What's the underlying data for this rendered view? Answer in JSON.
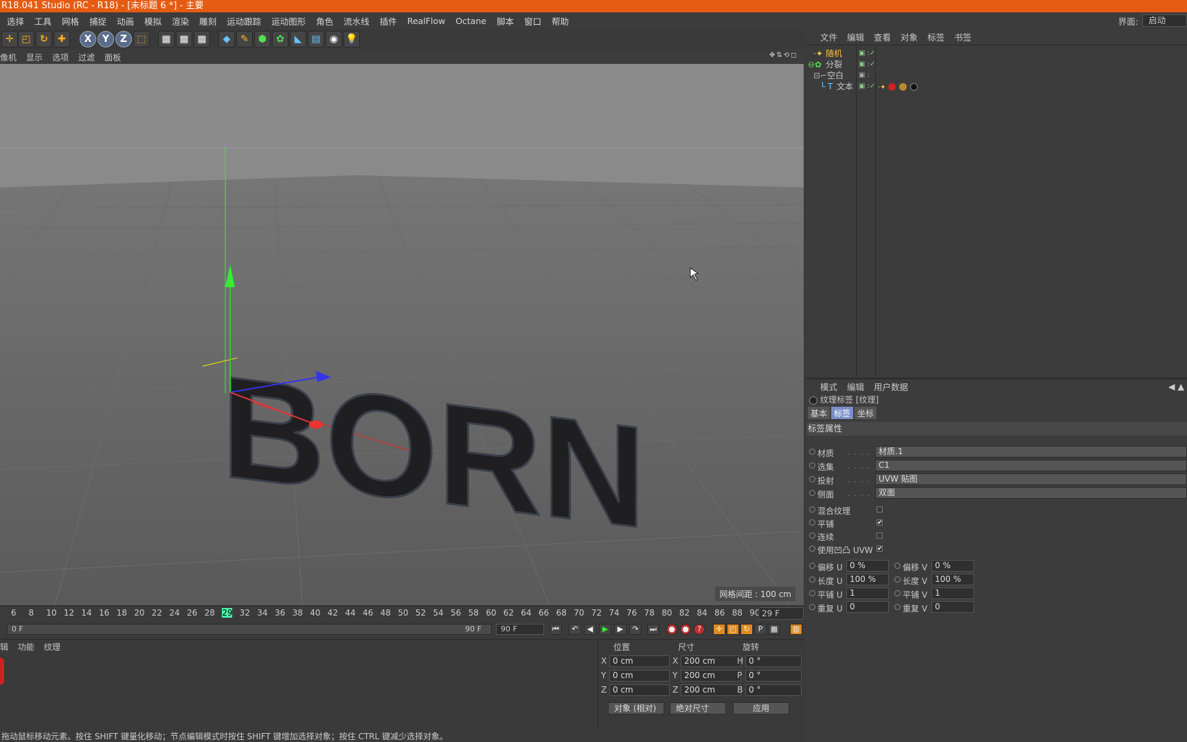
{
  "window": {
    "title": "R18.041 Studio (RC - R18) - [未标题 6 *] - 主要"
  },
  "menu": {
    "items": [
      "选择",
      "工具",
      "网格",
      "捕捉",
      "动画",
      "模拟",
      "渲染",
      "雕刻",
      "运动跟踪",
      "运动图形",
      "角色",
      "流水线",
      "插件",
      "RealFlow",
      "Octane",
      "脚本",
      "窗口",
      "帮助"
    ],
    "layout_label": "界面:",
    "layout_value": "启动"
  },
  "toolbar": {
    "icons": [
      "move-icon",
      "scale-icon",
      "rotate-icon",
      "transform-icon",
      "x-axis-icon",
      "y-axis-icon",
      "z-axis-icon",
      "coordinate-system-icon",
      "render-view-icon",
      "render-picture-viewer-icon",
      "render-settings-icon",
      "cube-icon",
      "pen-icon",
      "subdivision-icon",
      "cloner-icon",
      "deformer-icon",
      "floor-icon",
      "camera-icon",
      "light-icon"
    ],
    "axes": [
      "X",
      "Y",
      "Z"
    ]
  },
  "viewport": {
    "menu": [
      "像机",
      "显示",
      "选项",
      "过滤",
      "面板"
    ],
    "text3d": "BORN",
    "grid_info": "网格间距 : 100 cm"
  },
  "timeline": {
    "ticks": [
      "6",
      "8",
      "10",
      "12",
      "14",
      "16",
      "18",
      "20",
      "22",
      "24",
      "26",
      "28",
      "29",
      "32",
      "34",
      "36",
      "38",
      "40",
      "42",
      "44",
      "46",
      "48",
      "50",
      "52",
      "54",
      "56",
      "58",
      "60",
      "62",
      "64",
      "66",
      "68",
      "70",
      "72",
      "74",
      "76",
      "78",
      "80",
      "82",
      "84",
      "86",
      "88",
      "90"
    ],
    "current": "29",
    "current_frame": "29 F",
    "range_start": "0 F",
    "range_end": "90 F",
    "max_frame": "90 F"
  },
  "material_panel": {
    "menu": [
      "辑",
      "功能",
      "纹理"
    ]
  },
  "coordinates": {
    "headers": {
      "position": "位置",
      "size": "尺寸",
      "rotation": "旋转"
    },
    "rows": [
      {
        "axis": "X",
        "pos": "0 cm",
        "size_axis": "X",
        "size": "200 cm",
        "rot_axis": "H",
        "rot": "0 °"
      },
      {
        "axis": "Y",
        "pos": "0 cm",
        "size_axis": "Y",
        "size": "200 cm",
        "rot_axis": "P",
        "rot": "0 °"
      },
      {
        "axis": "Z",
        "pos": "0 cm",
        "size_axis": "Z",
        "size": "200 cm",
        "rot_axis": "B",
        "rot": "0 °"
      }
    ],
    "mode": "对象 (相对)",
    "size_mode": "绝对尺寸",
    "apply": "应用"
  },
  "status": "拖动鼠标移动元素。按住 SHIFT 键量化移动；节点编辑模式时按住 SHIFT 键增加选择对象；按住 CTRL 键减少选择对象。",
  "object_manager": {
    "menu": [
      "文件",
      "编辑",
      "查看",
      "对象",
      "标签",
      "书签"
    ],
    "objects": [
      {
        "name": "随机",
        "color": "#ffc040"
      },
      {
        "name": "分裂",
        "color": "#cccccc"
      },
      {
        "name": "空白",
        "color": "#cccccc"
      },
      {
        "name": "文本",
        "color": "#cccccc"
      }
    ]
  },
  "attributes": {
    "menu": [
      "模式",
      "编辑",
      "用户数据"
    ],
    "title": "纹理标签 [纹理]",
    "tabs": [
      "基本",
      "标签",
      "坐标"
    ],
    "section": "标签属性",
    "fields": [
      {
        "label": "材质",
        "value": "材质.1"
      },
      {
        "label": "选集",
        "value": "C1"
      },
      {
        "label": "投射",
        "value": "UVW 贴图"
      },
      {
        "label": "侧面",
        "value": "双面"
      }
    ],
    "checks": [
      {
        "label": "混合纹理",
        "checked": ""
      },
      {
        "label": "平铺",
        "checked": "✔"
      },
      {
        "label": "连续",
        "checked": ""
      },
      {
        "label": "使用凹凸 UVW",
        "checked": "✔"
      }
    ],
    "numbers": [
      {
        "l1": "偏移 U",
        "v1": "0 %",
        "l2": "偏移 V",
        "v2": "0 %"
      },
      {
        "l1": "长度 U",
        "v1": "100 %",
        "l2": "长度 V",
        "v2": "100 %"
      },
      {
        "l1": "平铺 U",
        "v1": "1",
        "l2": "平铺 V",
        "v2": "1"
      },
      {
        "l1": "重复 U",
        "v1": "0",
        "l2": "重复 V",
        "v2": "0"
      }
    ]
  }
}
